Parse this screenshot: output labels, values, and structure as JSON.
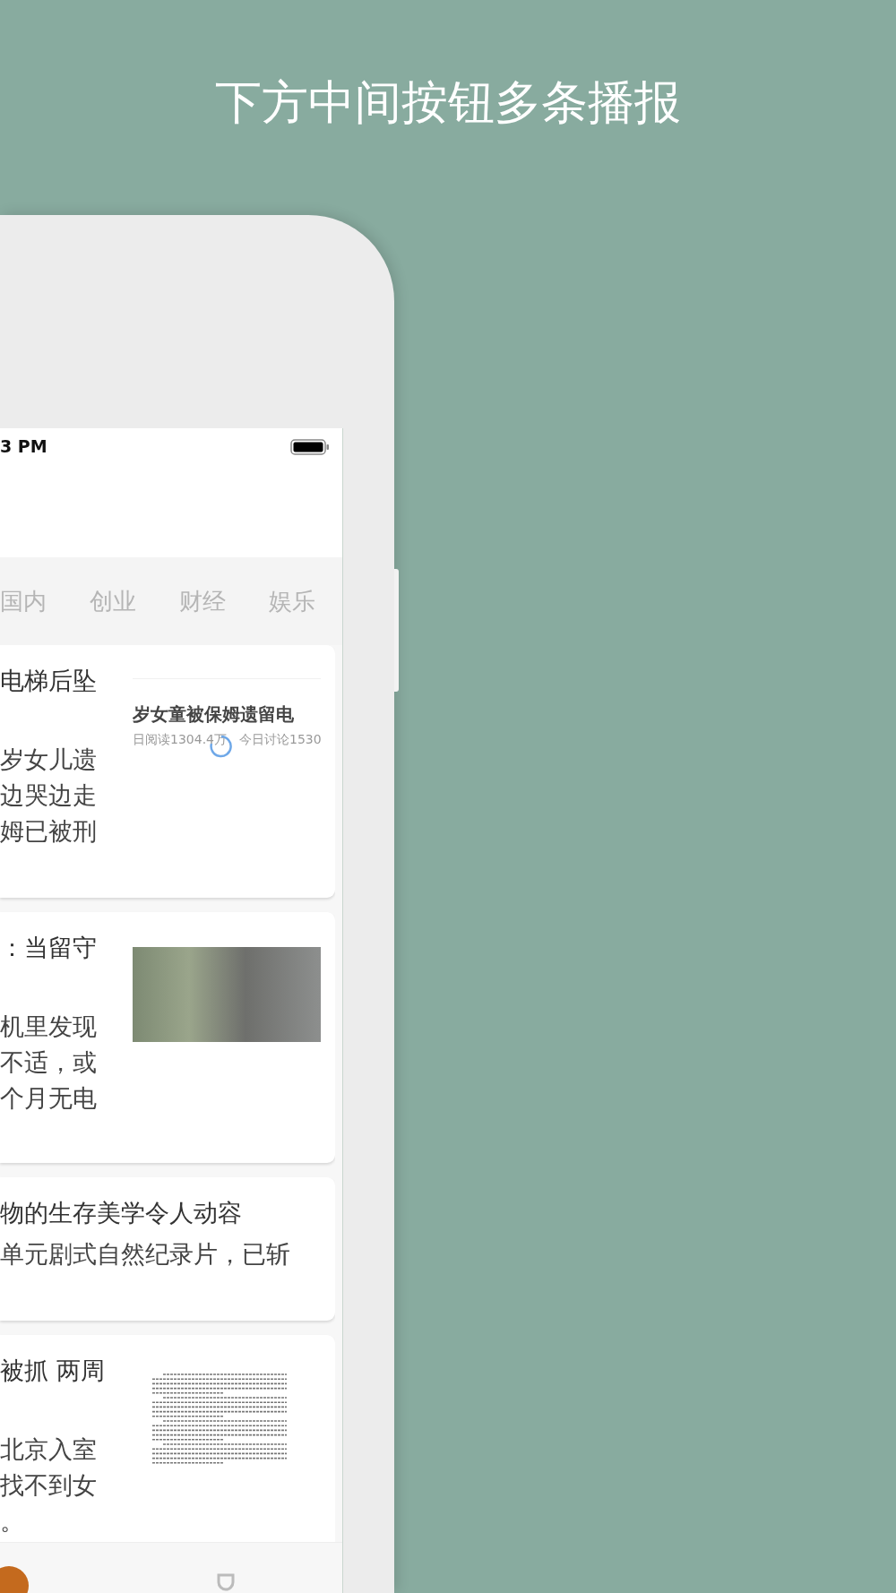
{
  "heading": "下方中间按钮多条播报",
  "status_bar": {
    "time": "3 PM"
  },
  "tabs": [
    {
      "label": "国内"
    },
    {
      "label": "创业"
    },
    {
      "label": "财经"
    },
    {
      "label": "娱乐"
    }
  ],
  "articles": [
    {
      "kind": "screenshot",
      "title": "电梯后坠",
      "lines": [
        "岁女儿遗",
        "边哭边走",
        "姆已被刑"
      ],
      "image": {
        "headline": "岁女童被保姆遗留电",
        "stats": [
          "日阅读1304.4万",
          "今日讨论1530"
        ]
      }
    },
    {
      "kind": "photo",
      "title": "：当留守",
      "lines": [
        "机里发现",
        "不适，或",
        "个月无电"
      ]
    },
    {
      "kind": "text",
      "title": "物的生存美学令人动容",
      "lines": [
        "单元剧式自然纪录片，已斩"
      ]
    },
    {
      "kind": "document",
      "title": "被抓 两周",
      "lines": [
        "北京入室",
        "找不到女",
        "。"
      ]
    }
  ]
}
